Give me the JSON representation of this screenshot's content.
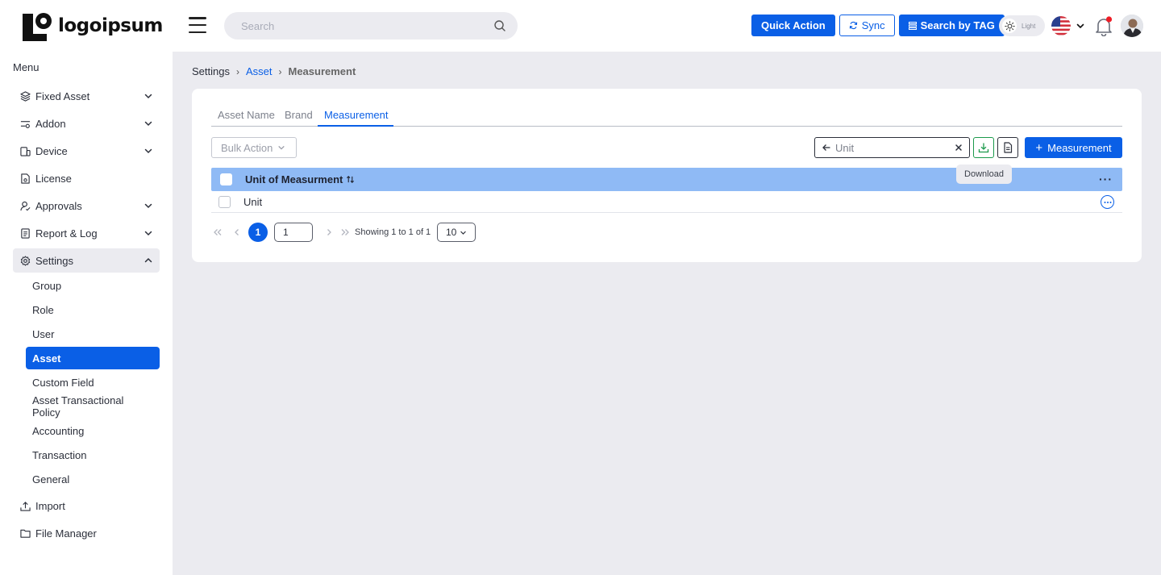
{
  "logo": {
    "text": "logoipsum"
  },
  "search": {
    "placeholder": "Search"
  },
  "header": {
    "quick_action": "Quick Action",
    "sync": "Sync",
    "search_by_tag": "Search by TAG",
    "theme_label": "Light"
  },
  "sidebar": {
    "menu_title": "Menu",
    "items": [
      {
        "label": "Fixed Asset",
        "icon": "layers-icon",
        "has_children": true
      },
      {
        "label": "Addon",
        "icon": "sliders-icon",
        "has_children": true
      },
      {
        "label": "Device",
        "icon": "device-icon",
        "has_children": true
      },
      {
        "label": "License",
        "icon": "license-icon",
        "has_children": false
      },
      {
        "label": "Approvals",
        "icon": "user-check-icon",
        "has_children": true
      },
      {
        "label": "Report & Log",
        "icon": "report-icon",
        "has_children": true
      },
      {
        "label": "Settings",
        "icon": "gear-icon",
        "has_children": true,
        "expanded": true
      }
    ],
    "settings_children": [
      "Group",
      "Role",
      "User",
      "Asset",
      "Custom Field",
      "Asset Transactional Policy",
      "Accounting",
      "Transaction",
      "General"
    ],
    "active_child": "Asset",
    "bottom_items": [
      {
        "label": "Import",
        "icon": "upload-icon"
      },
      {
        "label": "File Manager",
        "icon": "folder-icon"
      }
    ]
  },
  "breadcrumb": {
    "root": "Settings",
    "section": "Asset",
    "current": "Measurement"
  },
  "tabs": [
    {
      "label": "Asset Name"
    },
    {
      "label": "Brand"
    },
    {
      "label": "Measurement",
      "active": true
    }
  ],
  "toolbar": {
    "bulk_action": "Bulk Action",
    "filter_value": "Unit",
    "download_tooltip": "Download",
    "add_label": "Measurement"
  },
  "table": {
    "column": "Unit of Measurment",
    "rows": [
      {
        "name": "Unit"
      }
    ]
  },
  "pagination": {
    "current_page": "1",
    "page_input": "1",
    "info": "Showing 1 to 1 of 1",
    "page_size": "10"
  },
  "colors": {
    "primary": "#0a5fe6",
    "table_header": "#8fbaf5",
    "download_green": "#1c9a4c",
    "page_bg": "#ebebf0"
  }
}
